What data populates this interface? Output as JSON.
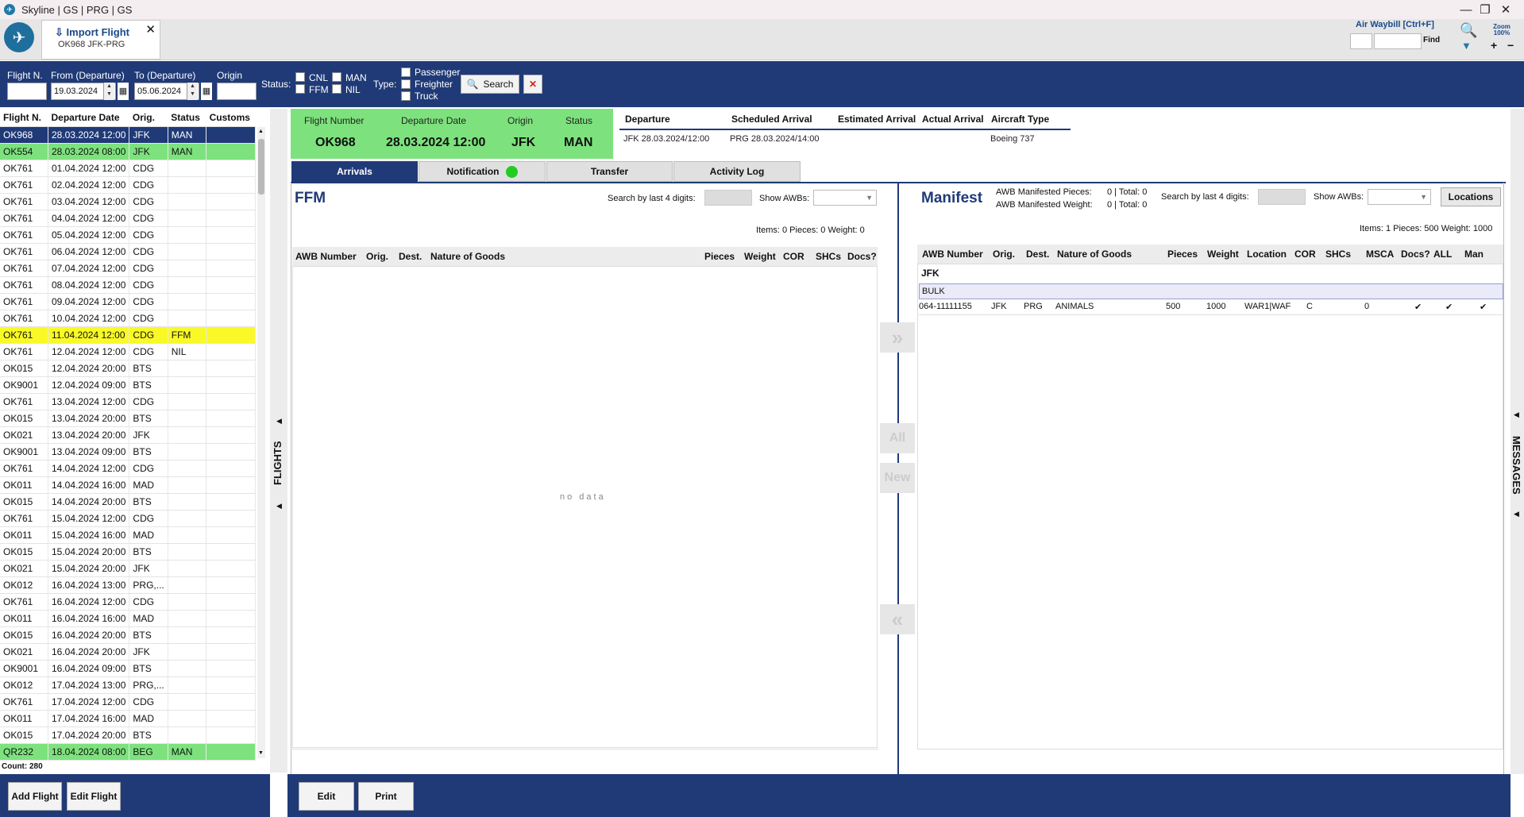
{
  "window": {
    "title": "Skyline | GS | PRG | GS"
  },
  "doc_tab": {
    "title": "Import Flight",
    "subtitle": "OK968   JFK-PRG"
  },
  "awb_search": {
    "label": "Air Waybill [Ctrl+F]",
    "find": "Find",
    "zoom": "Zoom 100%"
  },
  "filters": {
    "flight_n_label": "Flight N.",
    "from_label": "From (Departure)",
    "from_value": "19.03.2024",
    "to_label": "To (Departure)",
    "to_value": "05.06.2024",
    "origin_label": "Origin",
    "status_label": "Status:",
    "status_cnl": "CNL",
    "status_ffm": "FFM",
    "status_man": "MAN",
    "status_nil": "NIL",
    "type_label": "Type:",
    "type_passenger": "Passenger",
    "type_freighter": "Freighter",
    "type_truck": "Truck",
    "search_label": "Search"
  },
  "flights_table": {
    "headers": [
      "Flight N.",
      "Departure Date",
      "Orig.",
      "Status",
      "Customs"
    ],
    "rows": [
      [
        "OK968",
        "28.03.2024 12:00",
        "JFK",
        "MAN",
        ""
      ],
      [
        "OK554",
        "28.03.2024 08:00",
        "JFK",
        "MAN",
        ""
      ],
      [
        "OK761",
        "01.04.2024 12:00",
        "CDG",
        "",
        ""
      ],
      [
        "OK761",
        "02.04.2024 12:00",
        "CDG",
        "",
        ""
      ],
      [
        "OK761",
        "03.04.2024 12:00",
        "CDG",
        "",
        ""
      ],
      [
        "OK761",
        "04.04.2024 12:00",
        "CDG",
        "",
        ""
      ],
      [
        "OK761",
        "05.04.2024 12:00",
        "CDG",
        "",
        ""
      ],
      [
        "OK761",
        "06.04.2024 12:00",
        "CDG",
        "",
        ""
      ],
      [
        "OK761",
        "07.04.2024 12:00",
        "CDG",
        "",
        ""
      ],
      [
        "OK761",
        "08.04.2024 12:00",
        "CDG",
        "",
        ""
      ],
      [
        "OK761",
        "09.04.2024 12:00",
        "CDG",
        "",
        ""
      ],
      [
        "OK761",
        "10.04.2024 12:00",
        "CDG",
        "",
        ""
      ],
      [
        "OK761",
        "11.04.2024 12:00",
        "CDG",
        "FFM",
        ""
      ],
      [
        "OK761",
        "12.04.2024 12:00",
        "CDG",
        "NIL",
        ""
      ],
      [
        "OK015",
        "12.04.2024 20:00",
        "BTS",
        "",
        ""
      ],
      [
        "OK9001",
        "12.04.2024 09:00",
        "BTS",
        "",
        ""
      ],
      [
        "OK761",
        "13.04.2024 12:00",
        "CDG",
        "",
        ""
      ],
      [
        "OK015",
        "13.04.2024 20:00",
        "BTS",
        "",
        ""
      ],
      [
        "OK021",
        "13.04.2024 20:00",
        "JFK",
        "",
        ""
      ],
      [
        "OK9001",
        "13.04.2024 09:00",
        "BTS",
        "",
        ""
      ],
      [
        "OK761",
        "14.04.2024 12:00",
        "CDG",
        "",
        ""
      ],
      [
        "OK011",
        "14.04.2024 16:00",
        "MAD",
        "",
        ""
      ],
      [
        "OK015",
        "14.04.2024 20:00",
        "BTS",
        "",
        ""
      ],
      [
        "OK761",
        "15.04.2024 12:00",
        "CDG",
        "",
        ""
      ],
      [
        "OK011",
        "15.04.2024 16:00",
        "MAD",
        "",
        ""
      ],
      [
        "OK015",
        "15.04.2024 20:00",
        "BTS",
        "",
        ""
      ],
      [
        "OK021",
        "15.04.2024 20:00",
        "JFK",
        "",
        ""
      ],
      [
        "OK012",
        "16.04.2024 13:00",
        "PRG,...",
        "",
        ""
      ],
      [
        "OK761",
        "16.04.2024 12:00",
        "CDG",
        "",
        ""
      ],
      [
        "OK011",
        "16.04.2024 16:00",
        "MAD",
        "",
        ""
      ],
      [
        "OK015",
        "16.04.2024 20:00",
        "BTS",
        "",
        ""
      ],
      [
        "OK021",
        "16.04.2024 20:00",
        "JFK",
        "",
        ""
      ],
      [
        "OK9001",
        "16.04.2024 09:00",
        "BTS",
        "",
        ""
      ],
      [
        "OK012",
        "17.04.2024 13:00",
        "PRG,...",
        "",
        ""
      ],
      [
        "OK761",
        "17.04.2024 12:00",
        "CDG",
        "",
        ""
      ],
      [
        "OK011",
        "17.04.2024 16:00",
        "MAD",
        "",
        ""
      ],
      [
        "OK015",
        "17.04.2024 20:00",
        "BTS",
        "",
        ""
      ],
      [
        "QR232",
        "18.04.2024 08:00",
        "BEG",
        "MAN",
        ""
      ]
    ],
    "row_styles": [
      "sel",
      "green",
      "",
      "",
      "",
      "",
      "",
      "",
      "",
      "",
      "",
      "",
      "yellow",
      "",
      "",
      "",
      "",
      "",
      "",
      "",
      "",
      "",
      "",
      "",
      "",
      "",
      "",
      "",
      "",
      "",
      "",
      "",
      "",
      "",
      "",
      "",
      "",
      "green"
    ],
    "count": "Count: 280"
  },
  "left_footer": {
    "add": "Add Flight",
    "edit": "Edit Flight"
  },
  "flights_splitter": "FLIGHTS",
  "messages_splitter": "MESSAGES",
  "summary": {
    "h_flight": "Flight Number",
    "v_flight": "OK968",
    "h_date": "Departure Date",
    "v_date": "28.03.2024 12:00",
    "h_origin": "Origin",
    "v_origin": "JFK",
    "h_status": "Status",
    "v_status": "MAN"
  },
  "route": {
    "h_dep": "Departure",
    "v_dep": "JFK   28.03.2024/12:00",
    "h_sched": "Scheduled Arrival",
    "v_sched": "PRG   28.03.2024/14:00",
    "h_est": "Estimated Arrival",
    "h_act": "Actual Arrival",
    "h_type": "Aircraft Type",
    "v_type": "Boeing 737"
  },
  "tabs": [
    "Arrivals",
    "Notification",
    "Transfer",
    "Activity Log"
  ],
  "notification_dot_color": "#22cc22",
  "ffm": {
    "title": "FFM",
    "search_label": "Search by last 4 digits:",
    "show_label": "Show AWBs:",
    "totals": "Items: 0  Pieces: 0  Weight: 0",
    "headers": [
      "AWB Number",
      "Orig.",
      "Dest.",
      "Nature of Goods",
      "Pieces",
      "Weight",
      "COR",
      "SHCs",
      "Docs?"
    ],
    "empty": "no data"
  },
  "middle_buttons": {
    "move_right": "»",
    "all": "All",
    "new": "New",
    "move_left": "«"
  },
  "manifest": {
    "title": "Manifest",
    "pieces_label": "AWB Manifested Pieces:",
    "pieces_value": "0 | Total: 0",
    "weight_label": "AWB Manifested Weight:",
    "weight_value": "0 | Total: 0",
    "search_label": "Search by last 4 digits:",
    "show_label": "Show AWBs:",
    "locations": "Locations",
    "totals": "Items: 1  Pieces: 500  Weight: 1000",
    "headers": [
      "AWB Number",
      "Orig.",
      "Dest.",
      "Nature of Goods",
      "Pieces",
      "Weight",
      "Location",
      "COR",
      "SHCs",
      "MSCA",
      "Docs?",
      "ALL",
      "Man"
    ],
    "group": "JFK",
    "subgroup": "BULK",
    "row": [
      "064-11111155",
      "JFK",
      "PRG",
      "ANIMALS",
      "500",
      "1000",
      "WAR1|WAF",
      "C",
      "",
      "0",
      "✔",
      "✔",
      "✔"
    ]
  },
  "main_footer": {
    "edit": "Edit",
    "print": "Print"
  }
}
